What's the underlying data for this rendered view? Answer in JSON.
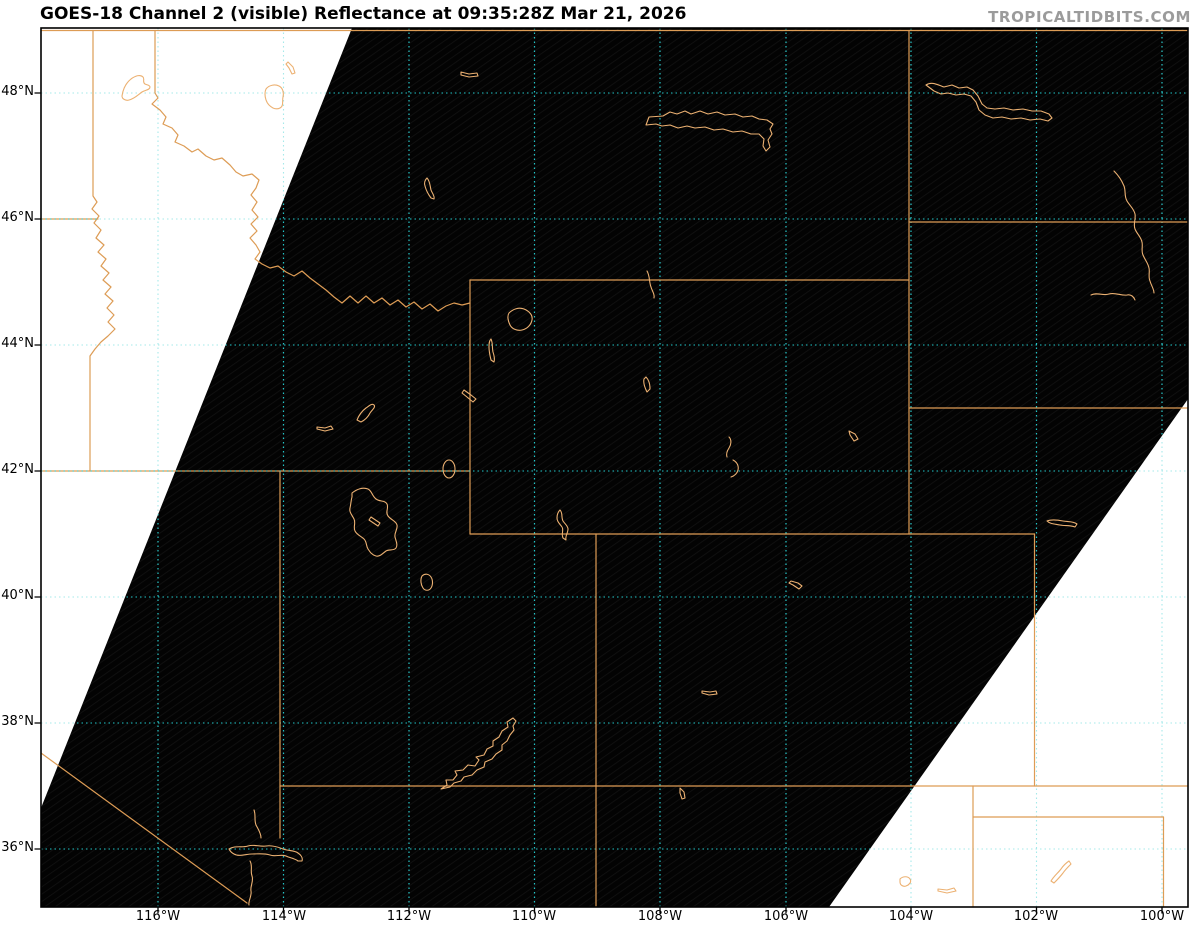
{
  "header": {
    "title": "GOES-18 Channel 2 (visible) Reflectance at 09:35:28Z Mar 21, 2026",
    "watermark": "TROPICALTIDBITS.COM"
  },
  "axes": {
    "lat_ticks": [
      {
        "label": "48°N"
      },
      {
        "label": "46°N"
      },
      {
        "label": "44°N"
      },
      {
        "label": "42°N"
      },
      {
        "label": "40°N"
      },
      {
        "label": "38°N"
      },
      {
        "label": "36°N"
      }
    ],
    "lon_ticks": [
      {
        "label": "116°W"
      },
      {
        "label": "114°W"
      },
      {
        "label": "112°W"
      },
      {
        "label": "110°W"
      },
      {
        "label": "108°W"
      },
      {
        "label": "106°W"
      },
      {
        "label": "104°W"
      },
      {
        "label": "102°W"
      },
      {
        "label": "100°W"
      }
    ]
  },
  "colors": {
    "page_bg": "#ffffff",
    "scan_bg": "#030303",
    "scan_texture": "#121212",
    "grid_over_white": "#a5e9ea",
    "grid_over_black": "#20c6c9",
    "state_border": "#dd9c55",
    "lake_outline": "#ecb172",
    "axis_spine": "#000000",
    "title_text": "#000000",
    "watermark_text": "#9b9b9b"
  }
}
